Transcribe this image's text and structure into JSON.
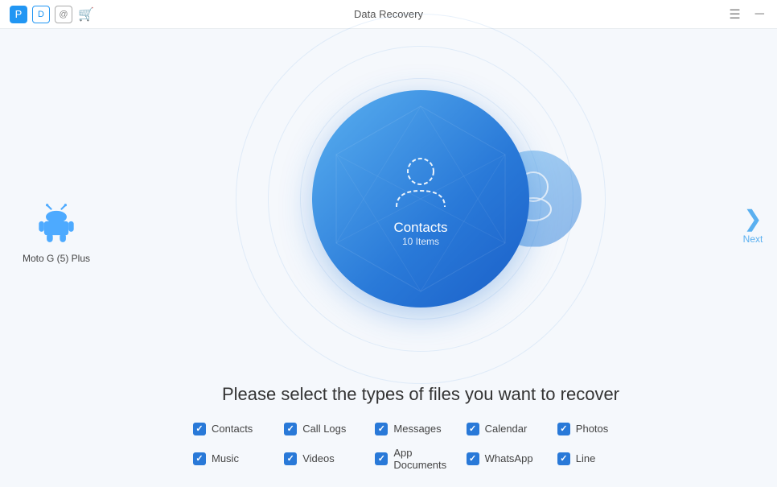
{
  "titleBar": {
    "title": "Data Recovery",
    "icons": [
      {
        "name": "logo-p",
        "symbol": "P",
        "style": "blue"
      },
      {
        "name": "doc-icon",
        "symbol": "D",
        "style": "outline"
      },
      {
        "name": "at-icon",
        "symbol": "@",
        "style": "gray"
      },
      {
        "name": "cart-icon",
        "symbol": "🛒",
        "style": "orange"
      }
    ],
    "controls": [
      {
        "name": "menu-button",
        "symbol": "☰"
      },
      {
        "name": "minimize-button",
        "symbol": "─"
      }
    ]
  },
  "device": {
    "name": "Moto G (5) Plus"
  },
  "mainCircle": {
    "label": "Contacts",
    "count": "10 Items"
  },
  "prompt": "Please select the types of files you want to recover",
  "fileTypes": [
    {
      "id": "contacts",
      "label": "Contacts",
      "checked": true
    },
    {
      "id": "call-logs",
      "label": "Call Logs",
      "checked": true
    },
    {
      "id": "messages",
      "label": "Messages",
      "checked": true
    },
    {
      "id": "calendar",
      "label": "Calendar",
      "checked": true
    },
    {
      "id": "photos",
      "label": "Photos",
      "checked": true
    },
    {
      "id": "music",
      "label": "Music",
      "checked": true
    },
    {
      "id": "videos",
      "label": "Videos",
      "checked": true
    },
    {
      "id": "app-documents",
      "label": "App Documents",
      "checked": true
    },
    {
      "id": "whatsapp",
      "label": "WhatsApp",
      "checked": true
    },
    {
      "id": "line",
      "label": "Line",
      "checked": true
    }
  ],
  "next": {
    "label": "Next",
    "arrow": "❯"
  }
}
